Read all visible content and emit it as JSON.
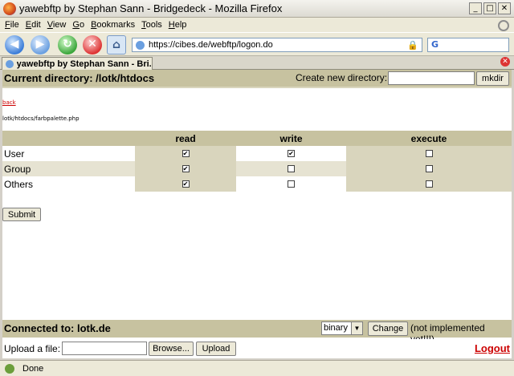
{
  "window": {
    "title": "yawebftp by Stephan Sann - Bridgedeck - Mozilla Firefox",
    "controls": {
      "minimize": "_",
      "maximize": "□",
      "close": "✕"
    }
  },
  "menu": [
    "File",
    "Edit",
    "View",
    "Go",
    "Bookmarks",
    "Tools",
    "Help"
  ],
  "menu_underline": [
    "F",
    "E",
    "V",
    "G",
    "B",
    "T",
    "H"
  ],
  "menu_rest": [
    "ile",
    "dit",
    "iew",
    "o",
    "ookmarks",
    "ools",
    "elp"
  ],
  "navigation": {
    "url": "https://cibes.de/webftp/logon.do",
    "search_engine_glyph": "G"
  },
  "tab": {
    "label": "yawebftp by Stephan Sann - Bri..."
  },
  "header": {
    "current_directory": "Current directory: /lotk/htdocs",
    "create_dir_label": "Create new directory:",
    "create_dir_value": "",
    "mkdir_label": "mkdir"
  },
  "back_link": "back",
  "file_path": "lotk/htdocs/farbpalette.php",
  "permissions": {
    "columns": [
      "read",
      "write",
      "execute"
    ],
    "rows": [
      {
        "label": "User",
        "read": true,
        "write": true,
        "execute": false
      },
      {
        "label": "Group",
        "read": true,
        "write": false,
        "execute": false
      },
      {
        "label": "Others",
        "read": true,
        "write": false,
        "execute": false
      }
    ],
    "submit_label": "Submit"
  },
  "connection": {
    "title": "Connected to: lotk.de",
    "mode": "binary",
    "change_label": "Change",
    "note": "(not implemented yet!!!)"
  },
  "upload": {
    "label": "Upload a file:",
    "browse_label": "Browse...",
    "upload_label": "Upload",
    "logout_label": "Logout"
  },
  "status": {
    "text": "Done"
  }
}
